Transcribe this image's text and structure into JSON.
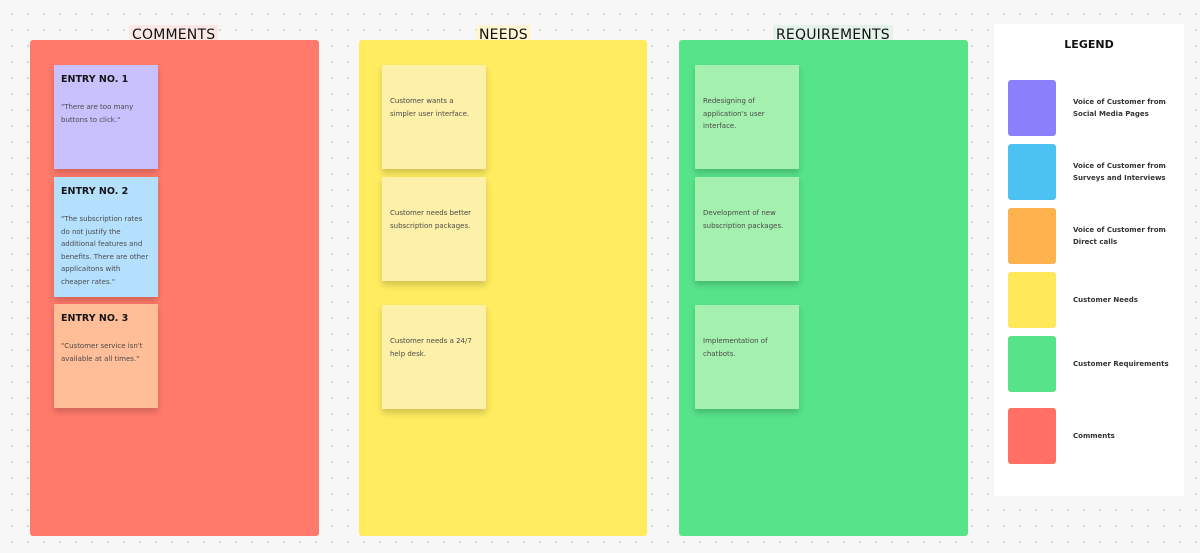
{
  "columns": [
    {
      "id": "comments",
      "title": "COMMENTS",
      "color": "#ff7a6b",
      "notes": [
        {
          "title": "ENTRY NO. 1",
          "text": "\"There are too many buttons to click.\"",
          "color": "#c8c1fd"
        },
        {
          "title": "ENTRY NO. 2",
          "text": "\"The subscription rates do not justify the additional features and benefits. There are other applicaitons with cheaper rates.\"",
          "color": "#b5e0fd"
        },
        {
          "title": "ENTRY NO. 3",
          "text": "\"Customer service isn't available at all times.\"",
          "color": "#ffbd98"
        }
      ]
    },
    {
      "id": "needs",
      "title": "NEEDS",
      "color": "#ffec5f",
      "notes": [
        {
          "text": "Customer wants a simpler user interface."
        },
        {
          "text": "Customer needs better subscription packages."
        },
        {
          "text": "Customer needs a 24/7 help desk."
        }
      ]
    },
    {
      "id": "requirements",
      "title": "REQUIREMENTS",
      "color": "#57e389",
      "notes": [
        {
          "text": "Redesigning of application's user interface."
        },
        {
          "text": "Development of new subscription packages."
        },
        {
          "text": "Implementation of chatbots."
        }
      ]
    }
  ],
  "legend": {
    "title": "LEGEND",
    "items": [
      {
        "label": "Voice of Customer from Social Media Pages",
        "color": "#8b80fb"
      },
      {
        "label": "Voice of Customer from Surveys and Interviews",
        "color": "#4cc2f3"
      },
      {
        "label": "Voice of Customer from Direct calls",
        "color": "#fdb24e"
      },
      {
        "label": "Customer Needs",
        "color": "#ffe95a"
      },
      {
        "label": "Customer Requirements",
        "color": "#57e389"
      },
      {
        "label": "Comments",
        "color": "#ff6f63"
      }
    ]
  }
}
